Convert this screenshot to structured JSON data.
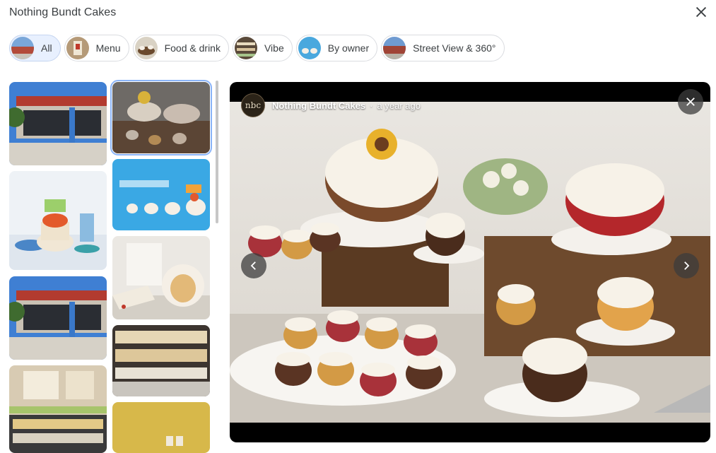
{
  "header": {
    "title": "Nothing Bundt Cakes"
  },
  "filters": [
    {
      "label": "All",
      "active": true
    },
    {
      "label": "Menu",
      "active": false
    },
    {
      "label": "Food & drink",
      "active": false
    },
    {
      "label": "Vibe",
      "active": false
    },
    {
      "label": "By owner",
      "active": false
    },
    {
      "label": "Street View & 360°",
      "active": false
    }
  ],
  "viewer": {
    "owner_name": "Nothing Bundt Cakes",
    "separator": "·",
    "timestamp": "a year ago",
    "avatar_initials": "nbc"
  },
  "icons": {
    "close": "close-icon",
    "prev": "chevron-left-icon",
    "next": "chevron-right-icon"
  },
  "colors": {
    "active_chip_bg": "#e8f0fe",
    "selected_outline": "#8ab4f8"
  }
}
